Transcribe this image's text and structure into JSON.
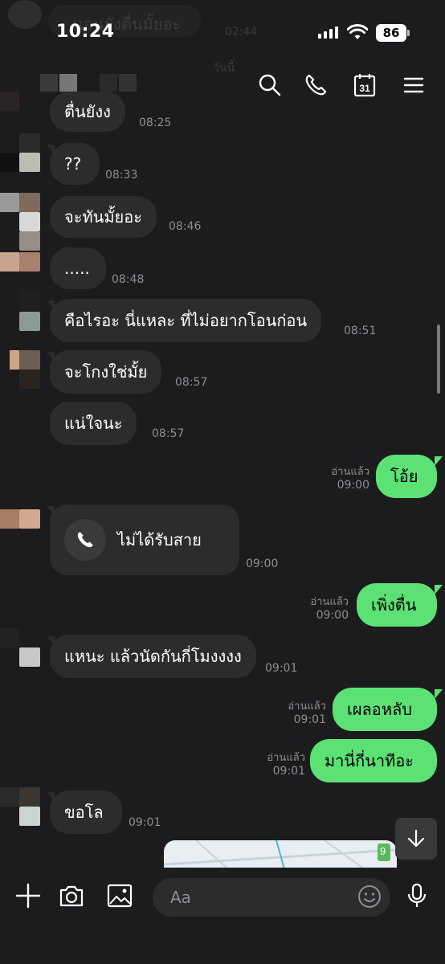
{
  "status_bar": {
    "time": "10:24",
    "battery": "86"
  },
  "background_peek": {
    "message": "นอนยังตื่นมั้ยอะ",
    "time": "02:44",
    "date": "วันนี้"
  },
  "messages": [
    {
      "text": "ตื่นยังง",
      "time": "08:25"
    },
    {
      "text": "??",
      "time": "08:33"
    },
    {
      "text": "จะทันมั้ยอะ",
      "time": "08:46"
    },
    {
      "text": ".....",
      "time": "08:48"
    },
    {
      "text": "คือไรอะ นี่แหละ ที่ไม่อยากโอนก่อน",
      "time": "08:51"
    },
    {
      "text": "จะโกงใช่มั้ย",
      "time": "08:57"
    },
    {
      "text": "แน่ใจนะ",
      "time": "08:57"
    },
    {
      "text": "โอ้ย",
      "time": "09:00",
      "read": "อ่านแล้ว"
    },
    {
      "text": "ไม่ได้รับสาย",
      "time": "09:00"
    },
    {
      "text": "เพิ่งตื่น",
      "time": "09:00",
      "read": "อ่านแล้ว"
    },
    {
      "text": "แหนะ แล้วนัดกันกี่โมงงงง",
      "time": "09:01"
    },
    {
      "text": "เผลอหลับ",
      "time": "09:01",
      "read": "อ่านแล้ว"
    },
    {
      "text": "มานี่กี่นาทีอะ",
      "time": "09:01",
      "read": "อ่านแล้ว"
    },
    {
      "text": "ขอโล",
      "time": "09:01"
    }
  ],
  "input": {
    "placeholder": "Aa"
  },
  "map_badge": "9",
  "colors": {
    "outgoing": "#5ce174",
    "incoming": "#2c2c2e",
    "background": "#1c1c1e"
  },
  "icons": [
    "search-icon",
    "phone-icon",
    "calendar-icon",
    "menu-icon",
    "plus-icon",
    "camera-icon",
    "image-icon",
    "emoji-icon",
    "mic-icon",
    "scroll-down-icon"
  ]
}
